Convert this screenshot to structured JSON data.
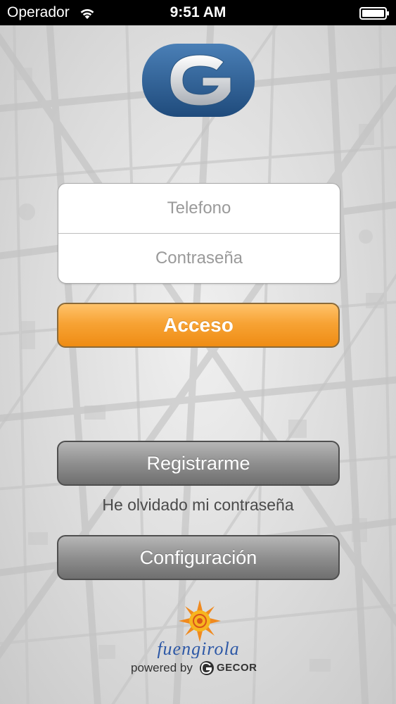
{
  "status_bar": {
    "carrier": "Operador",
    "time": "9:51 AM"
  },
  "login": {
    "phone_placeholder": "Telefono",
    "password_placeholder": "Contraseña",
    "access_label": "Acceso"
  },
  "actions": {
    "register_label": "Registrarme",
    "forgot_password_label": "He olvidado mi contraseña",
    "settings_label": "Configuración"
  },
  "footer": {
    "city_logo_text": "Fuengirola",
    "powered_by_label": "powered by",
    "gecor_label": "GECOR"
  },
  "colors": {
    "accent_orange": "#f7a335",
    "button_grey": "#8f8f8f",
    "logo_blue": "#2e5d92"
  }
}
